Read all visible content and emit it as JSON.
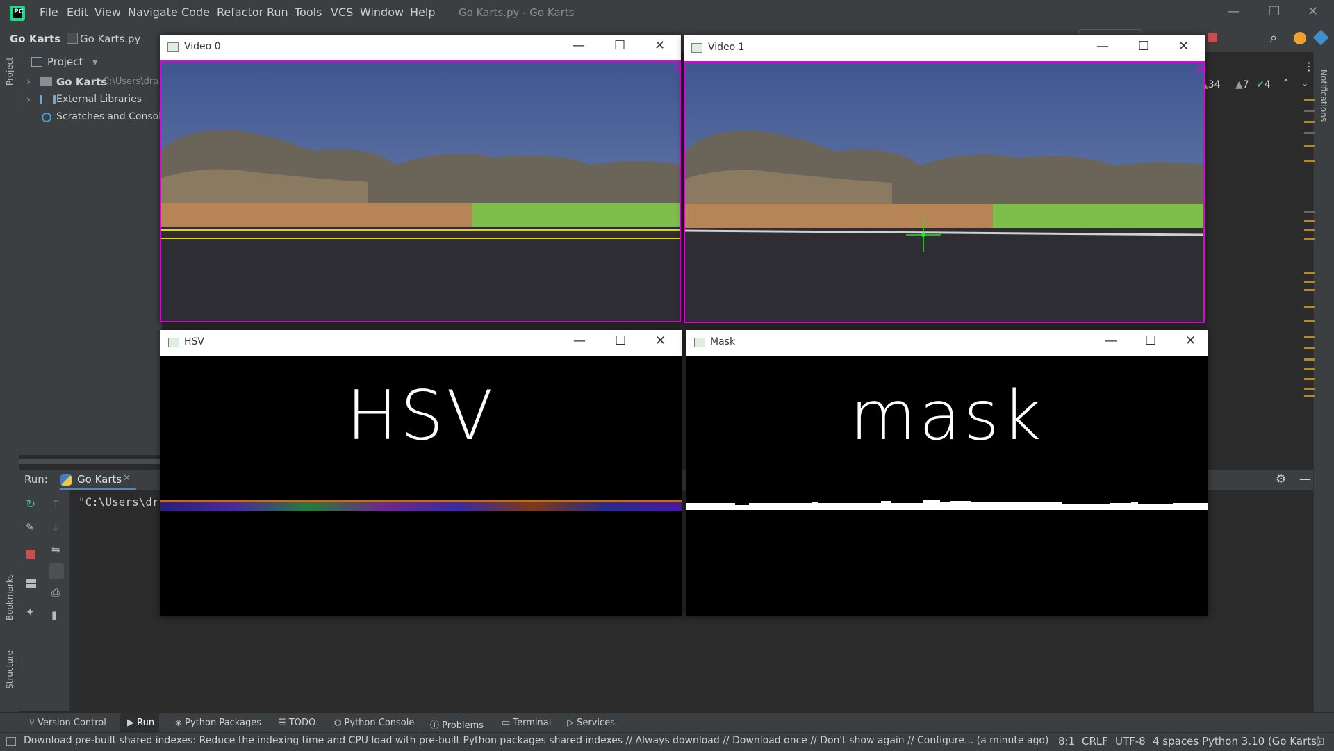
{
  "titlebar": {
    "menu": [
      "File",
      "Edit",
      "View",
      "Navigate",
      "Code",
      "Refactor",
      "Run",
      "Tools",
      "VCS",
      "Window",
      "Help"
    ],
    "window_title": "Go Karts.py - Go Karts"
  },
  "breadcrumb": {
    "project": "Go Karts",
    "file": "Go Karts.py"
  },
  "project_panel": {
    "title": "Project",
    "items": [
      {
        "label": "Go Karts",
        "path": "C:\\Users\\dra"
      },
      {
        "label": "External Libraries"
      },
      {
        "label": "Scratches and Consoles"
      }
    ]
  },
  "inspections": {
    "warnings": "34",
    "weak_warnings": "7",
    "ok": "4"
  },
  "left_stripe": {
    "project": "Project",
    "bookmarks": "Bookmarks",
    "structure": "Structure"
  },
  "right_stripe": {
    "notifications": "Notifications"
  },
  "run_panel": {
    "label": "Run:",
    "tab": "Go Karts",
    "output": "\"C:\\Users\\dr"
  },
  "windows": [
    {
      "title": "Video 0"
    },
    {
      "title": "Video 1"
    },
    {
      "title": "HSV",
      "overlay_text": "HSV"
    },
    {
      "title": "Mask",
      "overlay_text": "mask"
    }
  ],
  "bottom_tabs": [
    "Version Control",
    "Run",
    "Python Packages",
    "TODO",
    "Python Console",
    "Problems",
    "Terminal",
    "Services"
  ],
  "status": {
    "message": "Download pre-built shared indexes: Reduce the indexing time and CPU load with pre-built Python packages shared indexes // Always download // Download once // Don't show again // Configure... (a minute ago)",
    "position": "8:1",
    "line_sep": "CRLF",
    "encoding": "UTF-8",
    "indent": "4 spaces",
    "interpreter": "Python 3.10 (Go Karts)"
  },
  "colors": {
    "accent_green": "#21d789",
    "warning": "#b38a23",
    "magenta_roi": "#e000e0",
    "yellow_contour": "#e8d400",
    "crosshair": "#00ff00"
  }
}
